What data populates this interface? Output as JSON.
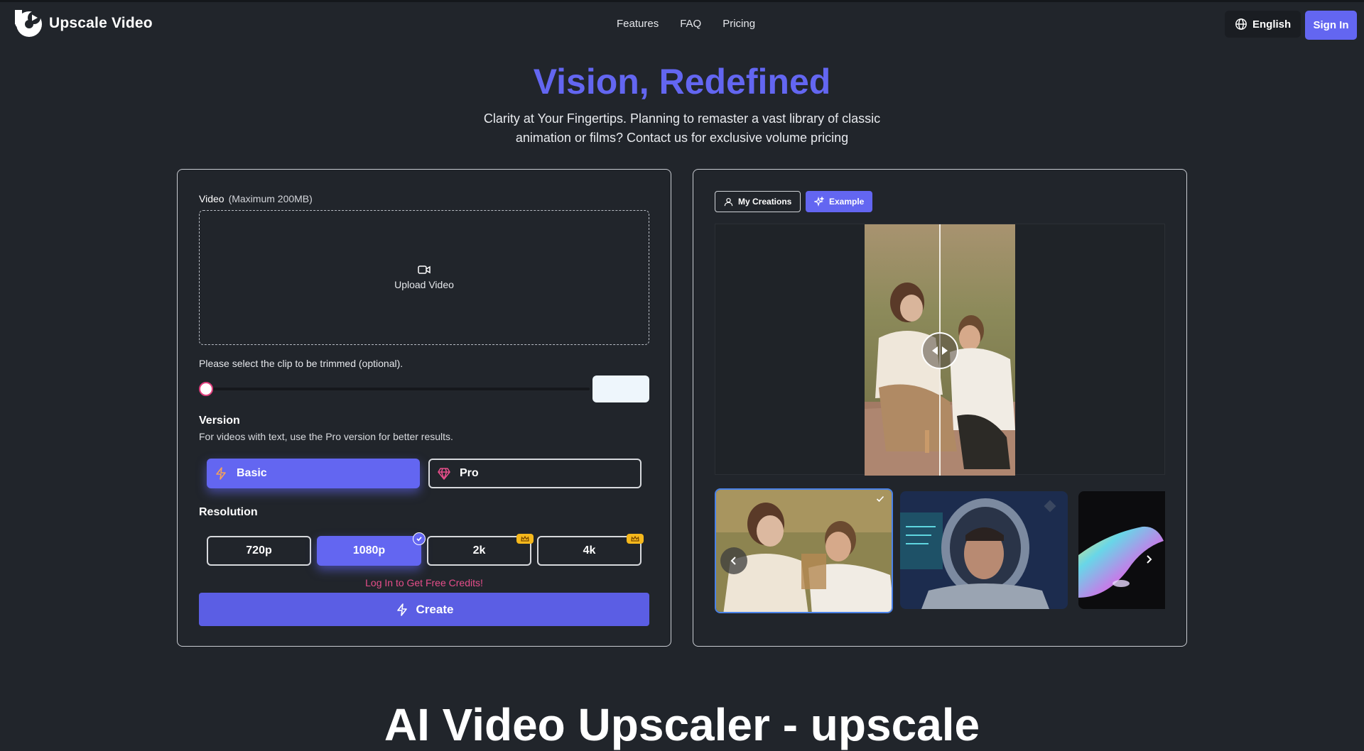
{
  "header": {
    "brand": "Upscale Video",
    "nav": [
      "Features",
      "FAQ",
      "Pricing"
    ],
    "language": "English",
    "signin": "Sign In"
  },
  "hero": {
    "title": "Vision, Redefined",
    "subtitle": "Clarity at Your Fingertips. Planning to remaster a vast library of classic animation or films? Contact us for exclusive volume pricing"
  },
  "form": {
    "video_label": "Video",
    "video_limit": "(Maximum 200MB)",
    "upload_label": "Upload Video",
    "trim_label": "Please select the clip to be trimmed (optional).",
    "version_title": "Version",
    "version_desc": "For videos with text, use the Pro version for better results.",
    "versions": [
      {
        "label": "Basic",
        "selected": true,
        "icon": "bolt-icon"
      },
      {
        "label": "Pro",
        "selected": false,
        "icon": "diamond-icon"
      }
    ],
    "resolution_title": "Resolution",
    "resolutions": [
      {
        "label": "720p",
        "selected": false,
        "premium": false
      },
      {
        "label": "1080p",
        "selected": true,
        "premium": false
      },
      {
        "label": "2k",
        "selected": false,
        "premium": true
      },
      {
        "label": "4k",
        "selected": false,
        "premium": true
      }
    ],
    "credits_link": "Log In to Get Free Credits!",
    "create_label": "Create"
  },
  "preview": {
    "tabs": {
      "creations": "My Creations",
      "example": "Example"
    },
    "active_tab": "Example",
    "thumbnails": [
      "picnic-couple",
      "astronaut",
      "abstract-iridescent"
    ],
    "selected_thumbnail": 0
  },
  "section": {
    "heading": "AI Video Upscaler - upscale"
  },
  "colors": {
    "accent": "#6366f1",
    "background": "#21252b",
    "link_pink": "#e64e8a",
    "premium_gold": "#f5b81c"
  }
}
